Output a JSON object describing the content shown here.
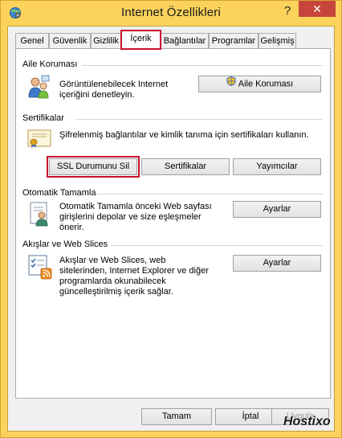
{
  "window": {
    "title": "Internet Özellikleri",
    "help_glyph": "?",
    "close_glyph": "✕",
    "title_bar_color": "#fbd25c",
    "close_color": "#c7463c"
  },
  "tabs": [
    "Genel",
    "Güvenlik",
    "Gizlilik",
    "İçerik",
    "Bağlantılar",
    "Programlar",
    "Gelişmiş"
  ],
  "active_tab": "İçerik",
  "sections": {
    "family": {
      "title": "Aile Koruması",
      "description": [
        "Görüntülenebilecek Internet",
        "içeriğini denetleyin."
      ],
      "button": "Aile Koruması"
    },
    "certificates": {
      "title": "Sertifikalar",
      "description": "Şifrelenmiş bağlantılar ve kimlik tanıma için sertifikaları kullanın.",
      "buttons": [
        "SSL Durumunu Sil",
        "Sertifikalar",
        "Yayımcılar"
      ]
    },
    "autocomplete": {
      "title": "Otomatik Tamamla",
      "description": [
        "Otomatik Tamamla önceki Web sayfası",
        "girişlerini depolar ve size eşleşmeler",
        "önerir."
      ],
      "button": "Ayarlar"
    },
    "feeds": {
      "title": "Akışlar ve Web Slices",
      "description": [
        "Akışlar ve Web Slices, web",
        "sitelerinden, Internet Explorer ve diğer",
        "programlarda okunabilecek",
        "güncelleştirilmiş içerik sağlar."
      ],
      "button": "Ayarlar"
    }
  },
  "footer": {
    "ok": "Tamam",
    "cancel": "İptal",
    "apply": "Uygula"
  },
  "watermark": "Hostixo",
  "highlight_color": "#c8102e"
}
